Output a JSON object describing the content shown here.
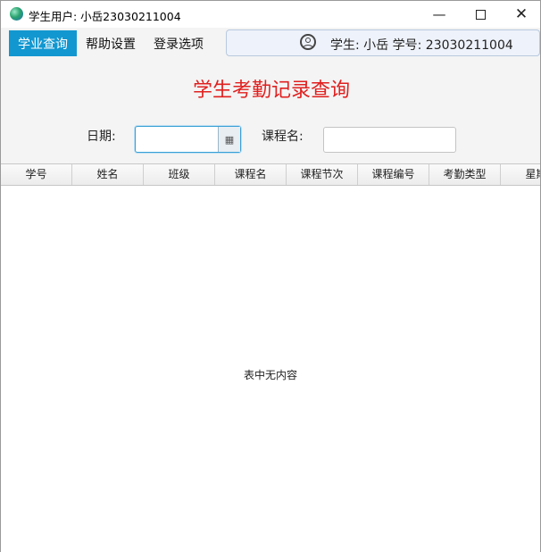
{
  "window": {
    "title": "学生用户: 小岳23030211004",
    "minimize_glyph": "—",
    "close_glyph": "✕"
  },
  "menu": {
    "items": [
      {
        "label": "学业查询"
      },
      {
        "label": "帮助设置"
      },
      {
        "label": "登录选项"
      }
    ]
  },
  "user": {
    "info": "学生: 小岳 学号: 23030211004"
  },
  "page": {
    "title": "学生考勤记录查询"
  },
  "filters": {
    "date_label": "日期:",
    "date_value": "",
    "calendar_glyph": "▦",
    "course_label": "课程名:",
    "course_value": ""
  },
  "table": {
    "columns": [
      "学号",
      "姓名",
      "班级",
      "课程名",
      "课程节次",
      "课程编号",
      "考勤类型",
      "星期"
    ],
    "empty_message": "表中无内容"
  },
  "colors": {
    "accent": "#1297d0",
    "title_red": "#e0201f"
  }
}
